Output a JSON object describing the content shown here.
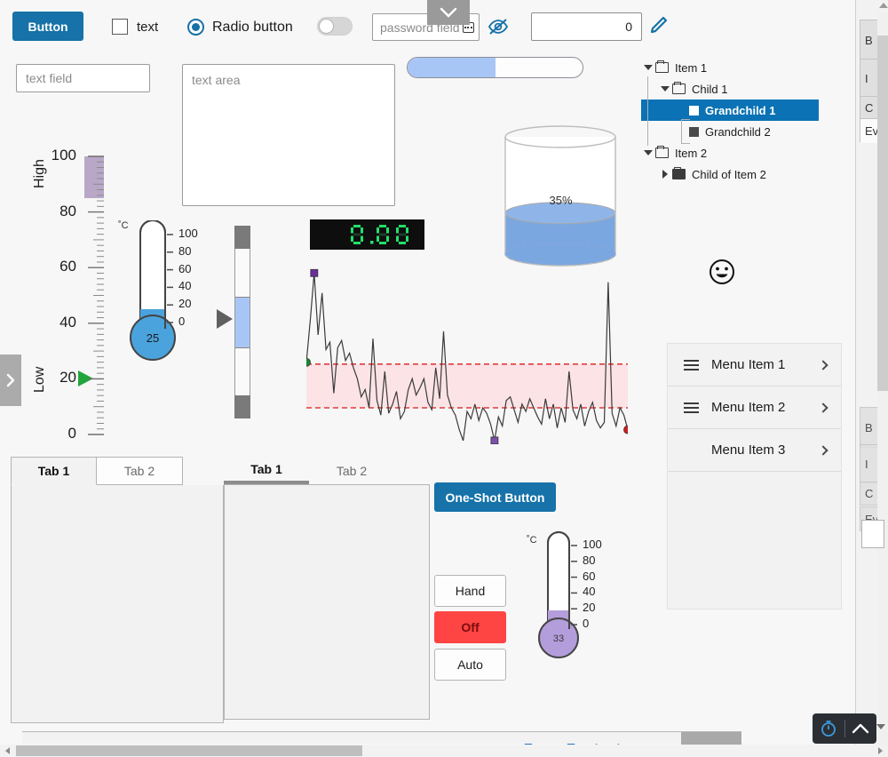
{
  "toolbar": {
    "button_label": "Button",
    "checkbox_label": "text",
    "checkbox_checked": false,
    "radio_label": "Radio button",
    "radio_checked": true,
    "toggle_on": false,
    "password_placeholder": "password field",
    "number_value": "0",
    "eye_off_icon": "eye-off-icon",
    "pencil_icon": "pencil-icon",
    "keyboard_icon": "keyboard-icon",
    "dropdown_icon": "chevron-down-icon"
  },
  "inputs": {
    "text_field_placeholder": "text field",
    "text_area_placeholder": "text area"
  },
  "progress": {
    "percent": 50,
    "fill_color": "#a8c6f5"
  },
  "tree": {
    "nodes": [
      {
        "label": "Item 1",
        "depth": 0,
        "type": "folder",
        "expanded": true,
        "selected": false
      },
      {
        "label": "Child 1",
        "depth": 1,
        "type": "folder",
        "expanded": true,
        "selected": false
      },
      {
        "label": "Grandchild 1",
        "depth": 2,
        "type": "leaf",
        "expanded": false,
        "selected": true
      },
      {
        "label": "Grandchild 2",
        "depth": 2,
        "type": "leaf",
        "expanded": false,
        "selected": false
      },
      {
        "label": "Item 2",
        "depth": 0,
        "type": "folder",
        "expanded": true,
        "selected": false
      },
      {
        "label": "Child of Item 2",
        "depth": 1,
        "type": "folder-solid",
        "expanded": false,
        "selected": false
      }
    ],
    "selection_color": "#0a72b5"
  },
  "smiley": {
    "icon": "smiley-face-icon"
  },
  "scale": {
    "ticks": [
      "100",
      "80",
      "60",
      "40",
      "20",
      "0"
    ],
    "high_label": "High",
    "low_label": "Low",
    "marker_value": 20,
    "marker_color": "#21a53c",
    "band_color": "#b9a7c8",
    "band_from": 85,
    "band_to": 100
  },
  "thermometer_main": {
    "unit": "˚C",
    "ticks": [
      "100",
      "80",
      "60",
      "40",
      "20",
      "0"
    ],
    "value": "25",
    "fill_color": "#4aa3dc"
  },
  "thermometer_small": {
    "unit": "˚C",
    "ticks": [
      "100",
      "80",
      "60",
      "40",
      "20",
      "0"
    ],
    "value": "33",
    "fill_color": "#b39ddb"
  },
  "vslider": {
    "value": 50,
    "thumb_color": "#a8c6f5"
  },
  "lcd": {
    "value": "0.00",
    "on_color": "#22e06a",
    "off_color": "#1e3d28",
    "background": "#0e0e0e"
  },
  "tank": {
    "percent_label": "35%",
    "percent": 35,
    "liquid_color": "#7ba7e0"
  },
  "chart_data": {
    "type": "line",
    "title": "",
    "xlabel": "",
    "ylabel": "",
    "grid": false,
    "legend": "none",
    "ylim": [
      0,
      100
    ],
    "band": {
      "low": 20,
      "high": 44,
      "fill": "#fbe3e6",
      "line_color": "#e03a3a",
      "style": "dashed"
    },
    "markers": [
      {
        "name": "start",
        "index": 0,
        "value": 45,
        "color": "#128a34",
        "shape": "circle"
      },
      {
        "name": "max",
        "index": 2,
        "value": 94,
        "color": "#6a2ea0",
        "shape": "square"
      },
      {
        "name": "min",
        "index": 48,
        "value": 2,
        "color": "#7b52ab",
        "shape": "square"
      },
      {
        "name": "end",
        "index": 99,
        "value": 8,
        "color": "#d01e1e",
        "shape": "circle"
      }
    ],
    "values": [
      45,
      68,
      94,
      60,
      83,
      52,
      56,
      28,
      53,
      57,
      46,
      50,
      42,
      36,
      26,
      30,
      20,
      58,
      24,
      16,
      40,
      17,
      22,
      29,
      14,
      18,
      30,
      36,
      27,
      31,
      36,
      23,
      19,
      42,
      25,
      62,
      27,
      20,
      16,
      8,
      2,
      18,
      14,
      22,
      13,
      20,
      17,
      11,
      2,
      15,
      10,
      24,
      26,
      19,
      12,
      22,
      18,
      25,
      20,
      15,
      11,
      25,
      14,
      22,
      9,
      20,
      12,
      40,
      19,
      14,
      22,
      10,
      18,
      23,
      13,
      9,
      12,
      89,
      17,
      10,
      20,
      16,
      8
    ]
  },
  "menu": {
    "items": [
      {
        "label": "Menu Item 1",
        "has_icon": true,
        "chevron": true
      },
      {
        "label": "Menu Item 2",
        "has_icon": true,
        "chevron": true
      },
      {
        "label": "Menu Item 3",
        "has_icon": false,
        "chevron": true
      }
    ]
  },
  "tabs_a": {
    "tabs": [
      "Tab 1",
      "Tab 2"
    ],
    "active": 0
  },
  "tabs_b": {
    "tabs": [
      "Tab 1",
      "Tab 2"
    ],
    "active": 0
  },
  "actions": {
    "one_shot_label": "One-Shot Button",
    "mode_buttons": [
      {
        "label": "Hand",
        "active": false
      },
      {
        "label": "Off",
        "active": true
      },
      {
        "label": "Auto",
        "active": false
      }
    ],
    "active_color": "#ff4444"
  },
  "right_panel": {
    "tabs": [
      "B",
      "I",
      "C",
      "Ev"
    ],
    "active_index": 3
  },
  "dev_toolbar": {
    "timer_icon": "stopwatch-icon",
    "collapse_icon": "chevron-up-icon"
  },
  "drawer": {
    "handle_icon": "chevron-right-icon"
  }
}
